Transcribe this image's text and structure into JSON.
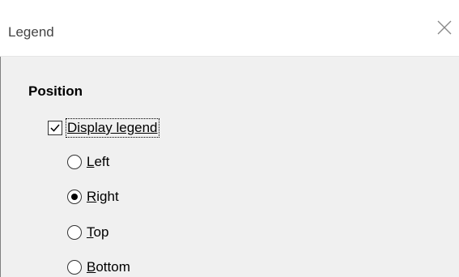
{
  "window": {
    "title": "Legend",
    "close_icon": "close-icon"
  },
  "position_section": {
    "heading": "Position",
    "display_legend": {
      "label": "Display legend",
      "checked": true
    },
    "options": [
      {
        "label_first": "L",
        "label_rest": "eft",
        "selected": false
      },
      {
        "label_first": "R",
        "label_rest": "ight",
        "selected": true
      },
      {
        "label_first": "T",
        "label_rest": "op",
        "selected": false
      },
      {
        "label_first": "B",
        "label_rest": "ottom",
        "selected": false
      }
    ]
  },
  "colors": {
    "panel_background": "#f0f0f0",
    "title_bar_background": "#ffffff"
  }
}
